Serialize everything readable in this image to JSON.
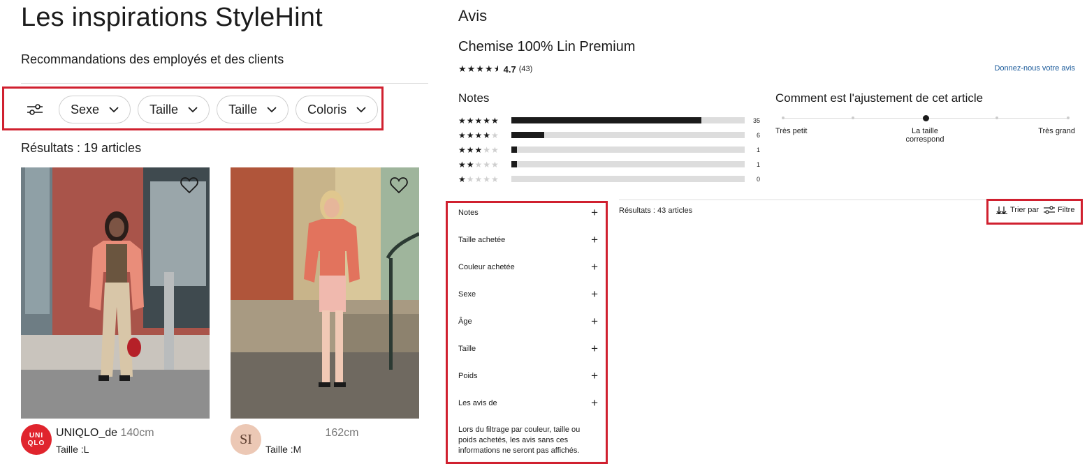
{
  "left": {
    "title": "Les inspirations StyleHint",
    "subtitle": "Recommandations des employés et des clients",
    "filters": [
      {
        "label": "Sexe"
      },
      {
        "label": "Taille"
      },
      {
        "label": "Taille"
      },
      {
        "label": "Coloris"
      }
    ],
    "results": "Résultats : 19 articles",
    "cards": [
      {
        "username": "UNIQLO_de",
        "height": "140cm",
        "size": "Taille :L",
        "avatar_text": "UNI QLO"
      },
      {
        "username": "",
        "height": "162cm",
        "size": "Taille :M",
        "avatar_text": "SI"
      }
    ]
  },
  "right": {
    "title": "Avis",
    "product": "Chemise 100% Lin Premium",
    "rating": "4.7",
    "rating_count": "(43)",
    "review_link": "Donnez-nous votre avis",
    "notes_heading": "Notes",
    "distribution": [
      {
        "stars": 5,
        "count": "35",
        "fraction": 0.814
      },
      {
        "stars": 4,
        "count": "6",
        "fraction": 0.14
      },
      {
        "stars": 3,
        "count": "1",
        "fraction": 0.023
      },
      {
        "stars": 2,
        "count": "1",
        "fraction": 0.023
      },
      {
        "stars": 1,
        "count": "0",
        "fraction": 0
      }
    ],
    "fit_heading": "Comment est l'ajustement de cet article",
    "fit_labels": {
      "small": "Très petit",
      "fits": "La taille correspond",
      "large": "Très grand"
    },
    "fit_position": 0.5,
    "facets": [
      "Notes",
      "Taille achetée",
      "Couleur achetée",
      "Sexe",
      "Âge",
      "Taille",
      "Poids",
      "Les avis de"
    ],
    "facet_note": "Lors du filtrage par couleur, taille ou poids achetés, les avis sans ces informations ne seront pas affichés.",
    "results": "Résultats : 43 articles",
    "sort_label": "Trier par",
    "filter_label": "Filtre"
  },
  "colors": {
    "highlight": "#d0202f",
    "link": "#1a5a9a",
    "brand_red": "#e0242d"
  }
}
